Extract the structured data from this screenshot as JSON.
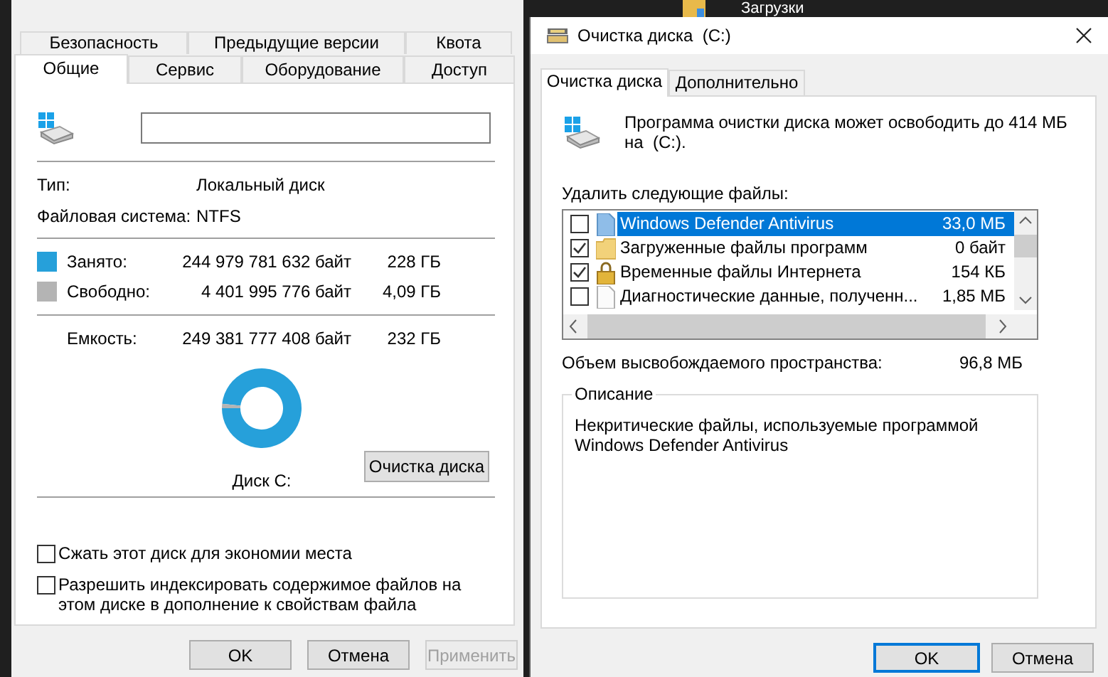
{
  "desktop_strip": {
    "folder_label": "Загрузки"
  },
  "properties_window": {
    "tabs_row_1": [
      {
        "label": "Безопасность",
        "selected": false
      },
      {
        "label": "Предыдущие версии",
        "selected": false
      },
      {
        "label": "Квота",
        "selected": false
      }
    ],
    "tabs_row_2": [
      {
        "label": "Общие",
        "selected": true
      },
      {
        "label": "Сервис",
        "selected": false
      },
      {
        "label": "Оборудование",
        "selected": false
      },
      {
        "label": "Доступ",
        "selected": false
      }
    ],
    "info": [
      {
        "label": "Тип:",
        "value": "Локальный диск"
      },
      {
        "label": "Файловая система:",
        "value": "NTFS"
      }
    ],
    "usage": [
      {
        "label": "Занято:",
        "bytes": "244 979 781 632 байт",
        "size": "228 ГБ",
        "color": "#26a0da"
      },
      {
        "label": "Свободно:",
        "bytes": "4 401 995 776 байт",
        "size": "4,09 ГБ",
        "color": "#b4b4b4"
      }
    ],
    "capacity": {
      "label": "Емкость:",
      "bytes": "249 381 777 408 байт",
      "size": "232 ГБ"
    },
    "chart_data": {
      "type": "donut",
      "values": [
        98.2,
        1.8
      ]
    },
    "drive_label": "Диск C:",
    "cleanup_button": "Очистка диска",
    "options": [
      {
        "label": "Сжать этот диск для экономии места",
        "checked": false
      },
      {
        "label": "Разрешить индексировать содержимое файлов на этом диске в дополнение к свойствам файла",
        "checked": false
      }
    ],
    "buttons": [
      {
        "label": "OK",
        "disabled": false
      },
      {
        "label": "Отмена",
        "disabled": false
      },
      {
        "label": "Применить",
        "disabled": true
      }
    ]
  },
  "cleanup_window": {
    "title": "Очистка диска  (C:)",
    "tabs": [
      {
        "label": "Очистка диска",
        "selected": true
      },
      {
        "label": "Дополнительно",
        "selected": false
      }
    ],
    "summary": "Программа очистки диска может освободить до 414 МБ на  (C:).",
    "files_label": "Удалить следующие файлы:",
    "files": [
      {
        "name": "Windows Defender Antivirus",
        "size": "33,0 МБ",
        "checked": false,
        "selected": true,
        "kind": "page"
      },
      {
        "name": "Загруженные файлы программ",
        "size": "0 байт",
        "checked": true,
        "selected": false,
        "kind": "folder"
      },
      {
        "name": "Временные файлы Интернета",
        "size": "154 КБ",
        "checked": true,
        "selected": false,
        "kind": "lock"
      },
      {
        "name": "Диагностические данные, полученн...",
        "size": "1,85 МБ",
        "checked": false,
        "selected": false,
        "kind": "document"
      }
    ],
    "space_label": "Объем высвобождаемого пространства:",
    "space_value": "96,8 МБ",
    "description": {
      "legend": "Описание",
      "text": "Некритические файлы, используемые программой Windows Defender Antivirus"
    },
    "buttons": [
      {
        "label": "OK",
        "default": true
      },
      {
        "label": "Отмена",
        "default": false
      }
    ]
  }
}
